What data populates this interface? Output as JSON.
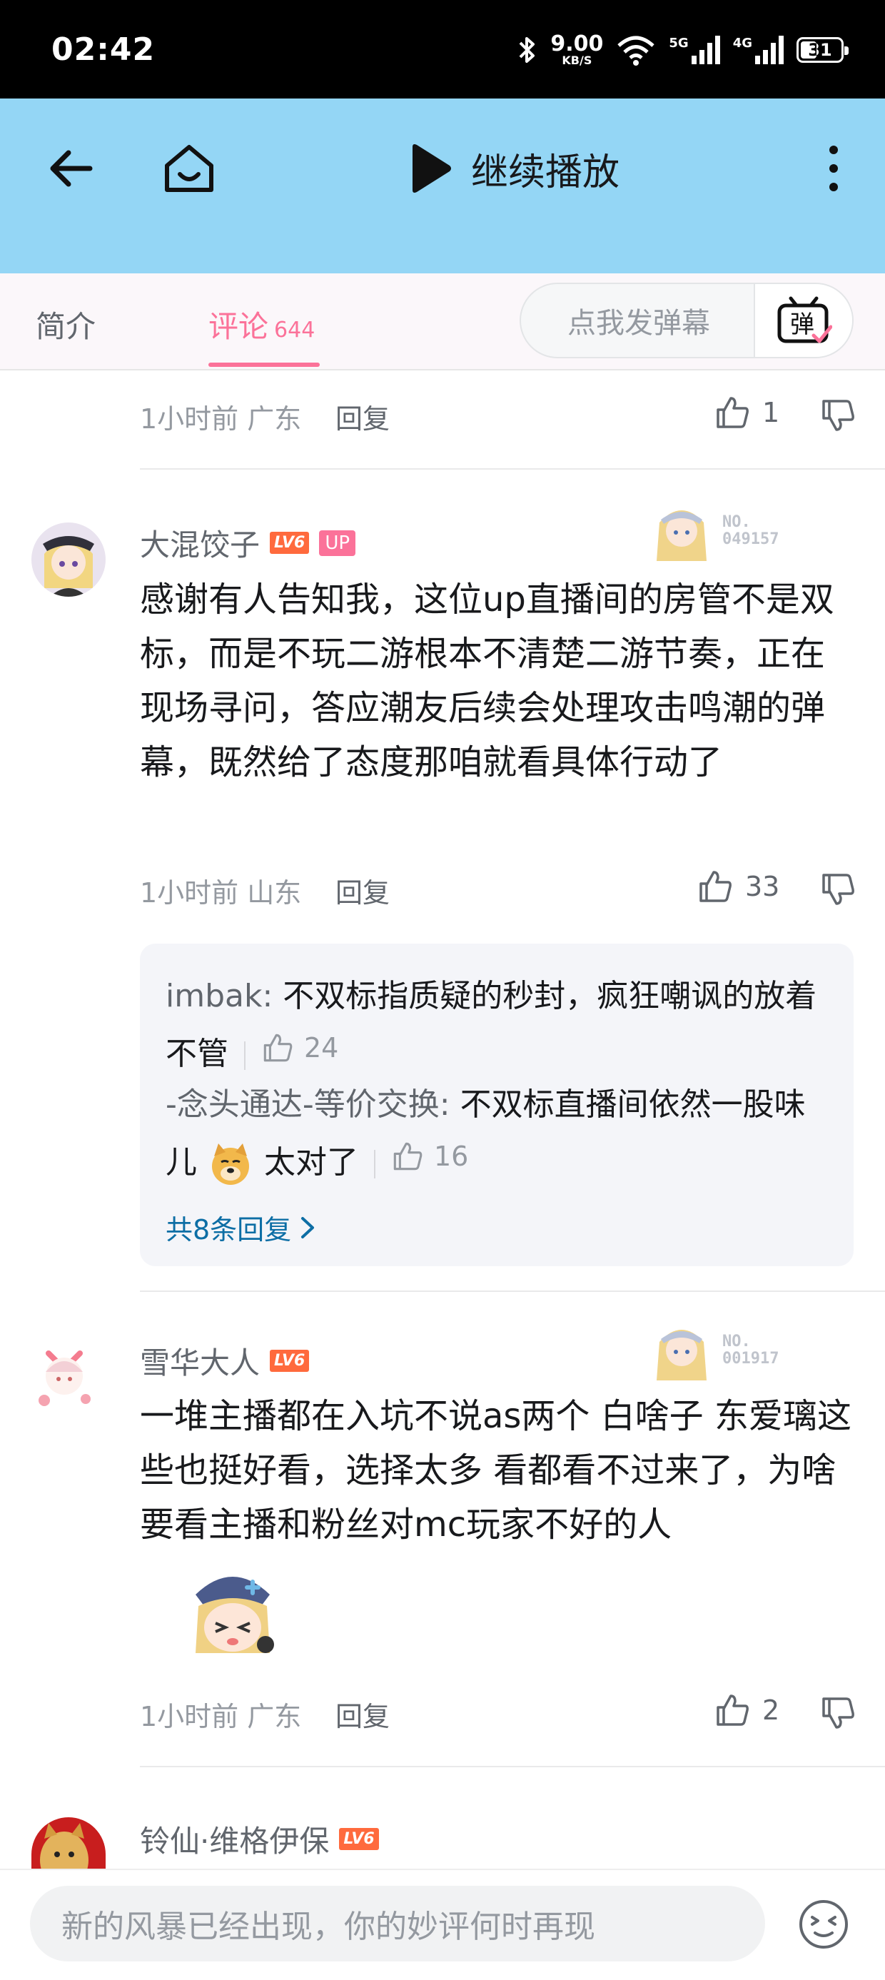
{
  "status": {
    "time": "02:42",
    "speed_value": "9.00",
    "speed_unit": "KB/S",
    "net1": "5G",
    "net2": "4G",
    "battery": "31"
  },
  "header": {
    "continue_label": "继续播放"
  },
  "tabs": {
    "intro": "简介",
    "comments": "评论",
    "comments_count": "644",
    "danmaku_placeholder": "点我发弹幕",
    "danmaku_button_glyph": "弹"
  },
  "comments": [
    {
      "meta": "1小时前 广东",
      "reply": "回复",
      "likes": "1"
    },
    {
      "user": "大混饺子",
      "level": "LV6",
      "up_badge": "UP",
      "fan_no": "NO.\n049157",
      "text": "感谢有人告知我，这位up直播间的房管不是双标，而是不玩二游根本不清楚二游节奏，正在现场寻问，答应潮友后续会处理攻击鸣潮的弹幕，既然给了态度那咱就看具体行动了",
      "meta": "1小时前 山东",
      "reply": "回复",
      "likes": "33",
      "replies": [
        {
          "user": "imbak:",
          "text": "不双标指质疑的秒封，疯狂嘲讽的放着不管",
          "likes": "24"
        },
        {
          "user": "-念头通达-等价交换:",
          "text": "不双标直播间依然一股味儿",
          "text2": "太对了",
          "likes": "16"
        }
      ],
      "more_replies": "共8条回复"
    },
    {
      "user": "雪华大人",
      "level": "LV6",
      "fan_no": "NO.\n001917",
      "text": "一堆主播都在入坑不说as两个 白啥子 东爱璃这些也挺好看，选择太多 看都看不过来了，为啥要看主播和粉丝对mc玩家不好的人",
      "meta": "1小时前 广东",
      "reply": "回复",
      "likes": "2"
    },
    {
      "user": "铃仙·维格伊保",
      "level": "LV6"
    }
  ],
  "bottom": {
    "placeholder": "新的风暴已经出现，你的妙评何时再现"
  }
}
